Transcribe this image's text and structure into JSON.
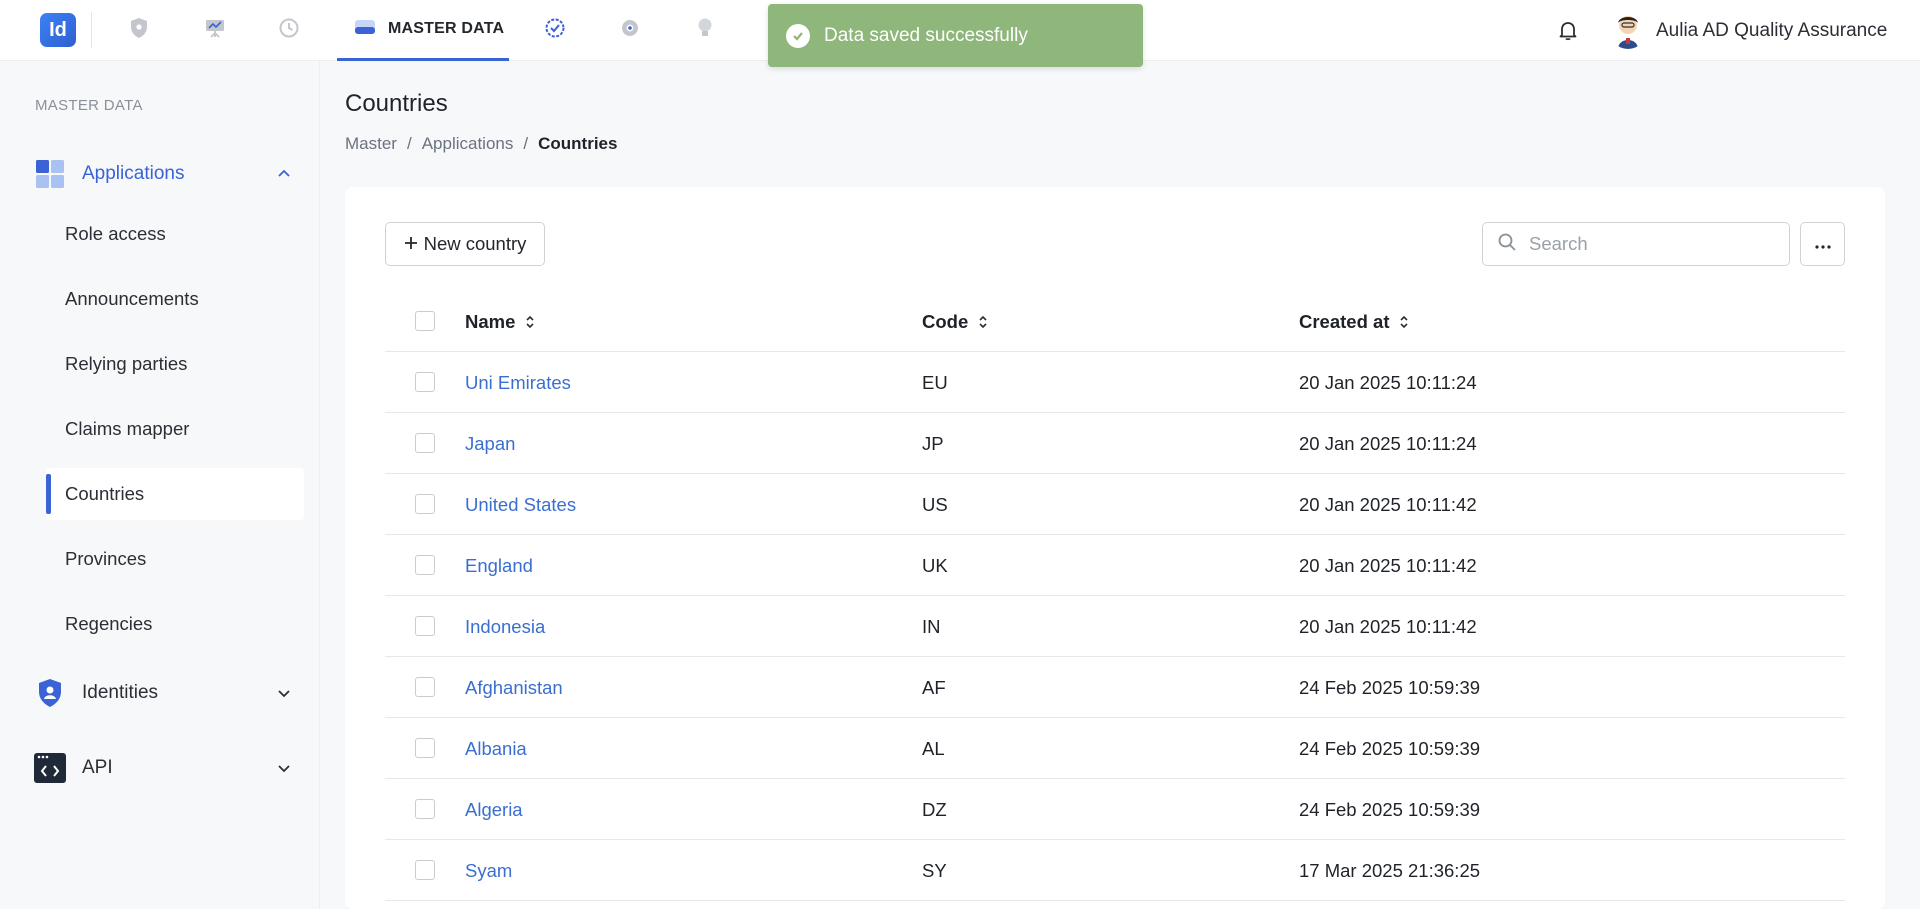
{
  "header": {
    "logo_text": "Id",
    "active_tab_label": "MASTER DATA",
    "user_name": "Aulia AD Quality Assurance",
    "nav_icons": [
      "shield-icon",
      "presentation-icon",
      "history-icon",
      "database-icon",
      "badge-check-icon",
      "gear-icon",
      "lightbulb-icon"
    ],
    "accent_color": "#3a63d6"
  },
  "toast": {
    "message": "Data saved successfully",
    "color": "#8fb67b"
  },
  "sidebar": {
    "heading": "MASTER DATA",
    "groups": [
      {
        "label": "Applications",
        "expanded": true,
        "items": [
          {
            "label": "Role access"
          },
          {
            "label": "Announcements"
          },
          {
            "label": "Relying parties"
          },
          {
            "label": "Claims mapper"
          },
          {
            "label": "Countries",
            "selected": true
          },
          {
            "label": "Provinces"
          },
          {
            "label": "Regencies"
          }
        ]
      },
      {
        "label": "Identities",
        "expanded": false
      },
      {
        "label": "API",
        "expanded": false
      }
    ]
  },
  "main": {
    "title": "Countries",
    "breadcrumb": [
      "Master",
      "Applications",
      "Countries"
    ],
    "new_button_label": "New country",
    "search_placeholder": "Search",
    "table": {
      "columns": [
        "Name",
        "Code",
        "Created at"
      ],
      "rows": [
        {
          "name": "Uni Emirates",
          "code": "EU",
          "created_at": "20 Jan 2025 10:11:24"
        },
        {
          "name": "Japan",
          "code": "JP",
          "created_at": "20 Jan 2025 10:11:24"
        },
        {
          "name": "United States",
          "code": "US",
          "created_at": "20 Jan 2025 10:11:42"
        },
        {
          "name": "England",
          "code": "UK",
          "created_at": "20 Jan 2025 10:11:42"
        },
        {
          "name": "Indonesia",
          "code": "IN",
          "created_at": "20 Jan 2025 10:11:42"
        },
        {
          "name": "Afghanistan",
          "code": "AF",
          "created_at": "24 Feb 2025 10:59:39"
        },
        {
          "name": "Albania",
          "code": "AL",
          "created_at": "24 Feb 2025 10:59:39"
        },
        {
          "name": "Algeria",
          "code": "DZ",
          "created_at": "24 Feb 2025 10:59:39"
        },
        {
          "name": "Syam",
          "code": "SY",
          "created_at": "17 Mar 2025 21:36:25"
        }
      ]
    }
  }
}
